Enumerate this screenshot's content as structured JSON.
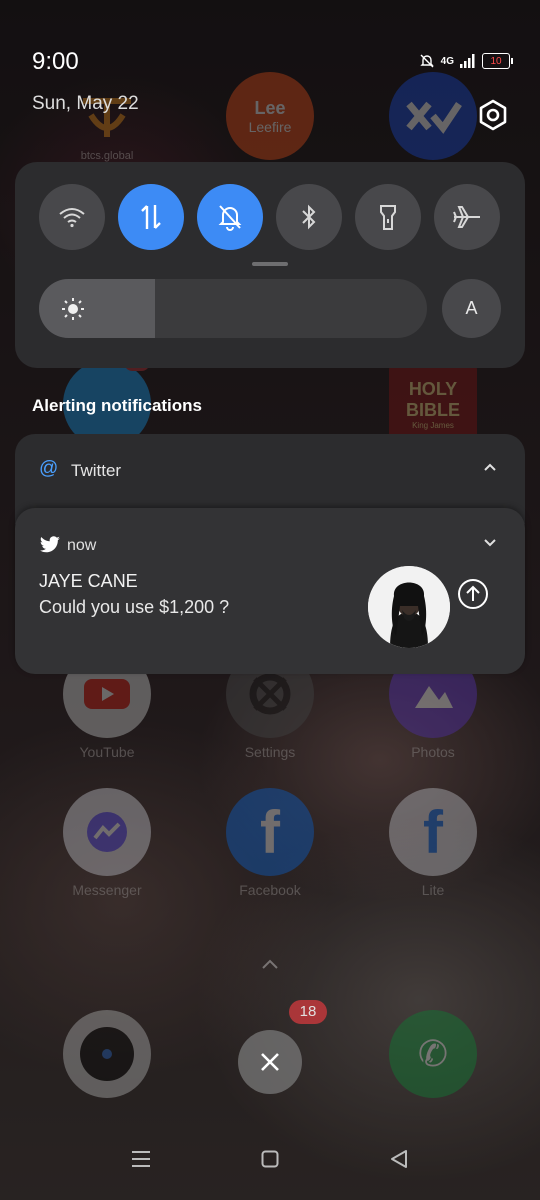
{
  "status_bar": {
    "time": "9:00",
    "date": "Sun, May 22",
    "network": "4G",
    "battery": "10"
  },
  "quick_settings": {
    "tiles": [
      {
        "name": "wifi",
        "state": "off"
      },
      {
        "name": "mobile-data",
        "state": "on"
      },
      {
        "name": "silent",
        "state": "on"
      },
      {
        "name": "bluetooth",
        "state": "off"
      },
      {
        "name": "flashlight",
        "state": "off"
      },
      {
        "name": "airplane-mode",
        "state": "off"
      }
    ],
    "brightness_level": 0.3,
    "auto_brightness_label": "A"
  },
  "notifications": {
    "section_title": "Alerting notifications",
    "group": {
      "app_name": "Twitter"
    },
    "item": {
      "time": "now",
      "sender": "JAYE CANE",
      "message": "Could you use $1,200 ?"
    }
  },
  "background_apps": [
    {
      "label": "YouTube"
    },
    {
      "label": "Settings"
    },
    {
      "label": "Photos"
    },
    {
      "label": "Messenger"
    },
    {
      "label": "Facebook"
    },
    {
      "label": "Lite"
    }
  ],
  "background_text": {
    "btcs": "btcs.global",
    "leefire_logo": "Lee",
    "leefire": "Leefire",
    "holy_bible_line1": "HOLY",
    "holy_bible_line2": "BIBLE",
    "holy_bible_sub": "King James",
    "twitter_badge": "18"
  },
  "dock_badge": "18",
  "colors": {
    "accent": "#3d8bf5",
    "panel": "#2c2c2e"
  }
}
